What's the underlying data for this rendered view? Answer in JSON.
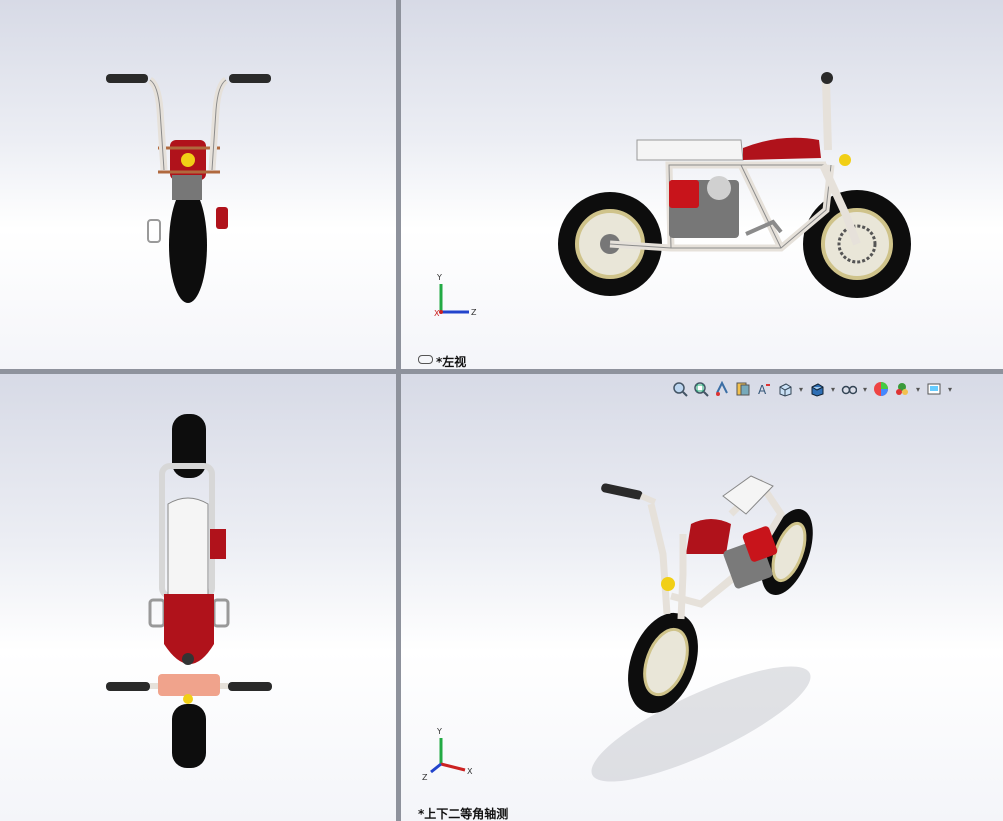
{
  "viewports": {
    "front": {
      "label": ""
    },
    "left": {
      "label": "*左视"
    },
    "top": {
      "label": ""
    },
    "iso": {
      "label": "*上下二等角轴测"
    }
  },
  "triad": {
    "x": "X",
    "y": "Y",
    "z": "Z"
  },
  "toolbar": {
    "icons": [
      "zoom-to-fit-icon",
      "zoom-to-area-icon",
      "previous-view-icon",
      "section-view-icon",
      "dynamic-annotation-icon",
      "view-orientation-icon",
      "display-style-icon",
      "hide-show-items-icon",
      "edit-appearance-icon",
      "apply-scene-icon",
      "view-settings-icon"
    ]
  },
  "colors": {
    "frame": "#e6e1da",
    "tank_red": "#b0121b",
    "seat": "#f5f5f5",
    "tire": "#0d0d0d",
    "rim": "#cfc38a",
    "headlight": "#f1cf16",
    "triad_x": "#cc2222",
    "triad_y": "#22aa44",
    "triad_z": "#2244cc"
  }
}
